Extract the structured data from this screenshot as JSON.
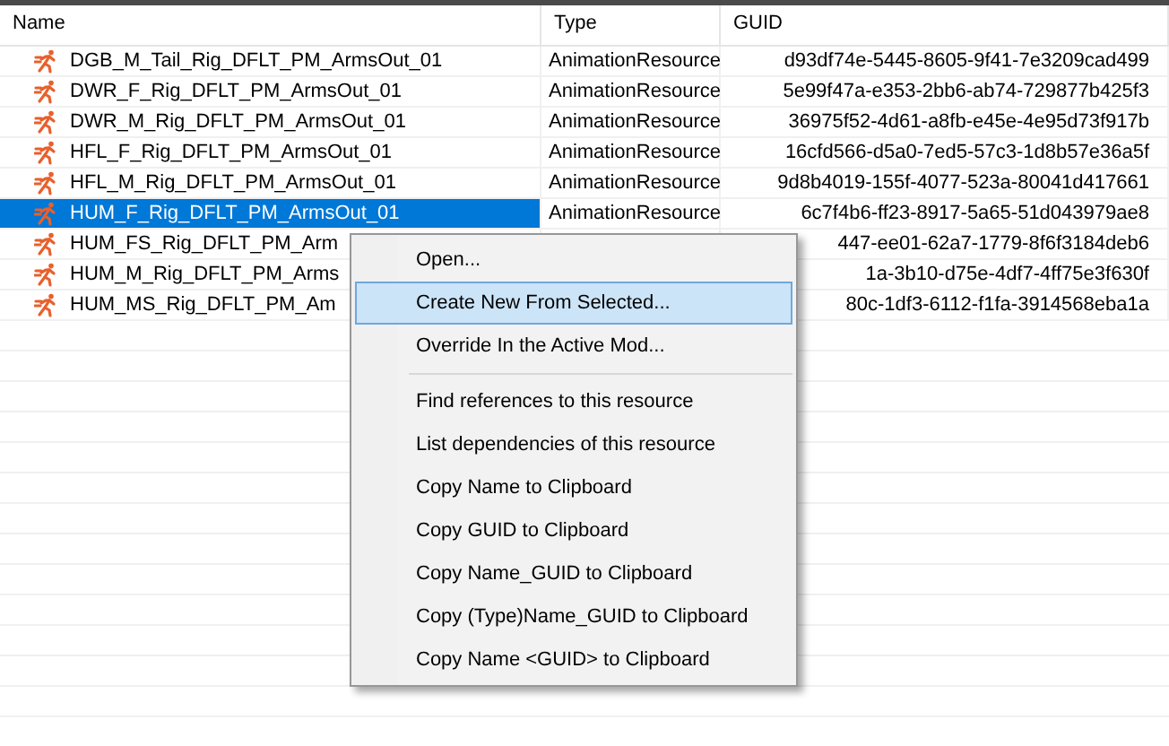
{
  "columns": [
    {
      "label": "Name"
    },
    {
      "label": "Type"
    },
    {
      "label": "GUID"
    }
  ],
  "rows": [
    {
      "name": "DGB_M_Tail_Rig_DFLT_PM_ArmsOut_01",
      "type": "AnimationResource",
      "guid": "d93df74e-5445-8605-9f41-7e3209cad499",
      "selected": false
    },
    {
      "name": "DWR_F_Rig_DFLT_PM_ArmsOut_01",
      "type": "AnimationResource",
      "guid": "5e99f47a-e353-2bb6-ab74-729877b425f3",
      "selected": false
    },
    {
      "name": "DWR_M_Rig_DFLT_PM_ArmsOut_01",
      "type": "AnimationResource",
      "guid": "36975f52-4d61-a8fb-e45e-4e95d73f917b",
      "selected": false
    },
    {
      "name": "HFL_F_Rig_DFLT_PM_ArmsOut_01",
      "type": "AnimationResource",
      "guid": "16cfd566-d5a0-7ed5-57c3-1d8b57e36a5f",
      "selected": false
    },
    {
      "name": "HFL_M_Rig_DFLT_PM_ArmsOut_01",
      "type": "AnimationResource",
      "guid": "9d8b4019-155f-4077-523a-80041d417661",
      "selected": false
    },
    {
      "name": "HUM_F_Rig_DFLT_PM_ArmsOut_01",
      "type": "AnimationResource",
      "guid": "6c7f4b6-ff23-8917-5a65-51d043979ae8",
      "selected": true
    },
    {
      "name": "HUM_FS_Rig_DFLT_PM_Arm",
      "guid": "447-ee01-62a7-1779-8f6f3184deb6",
      "selected": false
    },
    {
      "name": "HUM_M_Rig_DFLT_PM_Arms",
      "guid": "1a-3b10-d75e-4df7-4ff75e3f630f",
      "selected": false
    },
    {
      "name": "HUM_MS_Rig_DFLT_PM_Am",
      "guid": "80c-1df3-6112-f1fa-3914568eba1a",
      "selected": false
    }
  ],
  "context_menu": {
    "groups": [
      [
        {
          "label": "Open...",
          "selected": false
        },
        {
          "label": "Create New From Selected...",
          "selected": true
        },
        {
          "label": "Override In the Active Mod...",
          "selected": false
        }
      ],
      [
        {
          "label": "Find references to this resource",
          "selected": false
        },
        {
          "label": "List dependencies of this resource",
          "selected": false
        },
        {
          "label": "Copy Name to Clipboard",
          "selected": false
        },
        {
          "label": "Copy GUID to Clipboard",
          "selected": false
        },
        {
          "label": "Copy Name_GUID to Clipboard",
          "selected": false
        },
        {
          "label": "Copy (Type)Name_GUID to Clipboard",
          "selected": false
        },
        {
          "label": "Copy Name <GUID> to Clipboard",
          "selected": false
        }
      ]
    ]
  }
}
